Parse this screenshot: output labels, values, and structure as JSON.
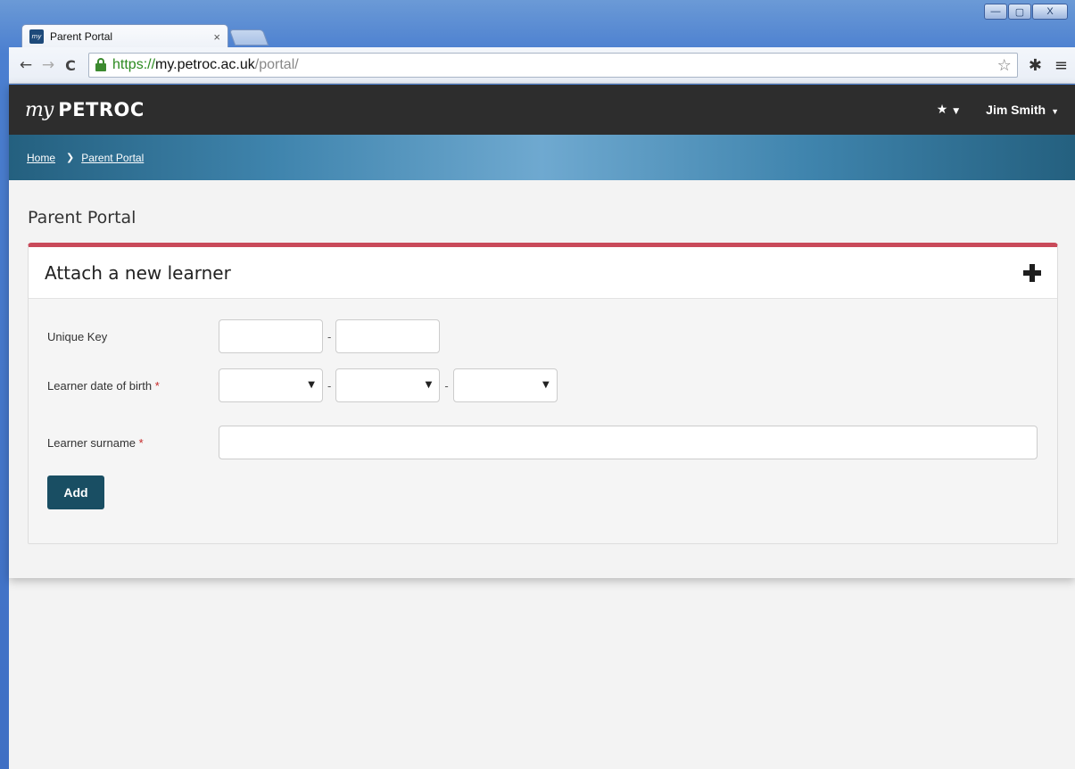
{
  "browser": {
    "tab_title": "Parent Portal",
    "tab_close": "×",
    "url_scheme": "https://",
    "url_host": "my.petroc.ac.uk",
    "url_path": "/portal/",
    "window_controls": {
      "minimize": "—",
      "maximize": "▢",
      "close": "X"
    }
  },
  "header": {
    "logo_my": "my",
    "logo_petroc": "PETROC",
    "favorites_label": "★",
    "user_name": "Jim Smith"
  },
  "breadcrumb": {
    "items": [
      "Home",
      "Parent Portal"
    ]
  },
  "page": {
    "title": "Parent Portal"
  },
  "panel": {
    "title": "Attach a new learner",
    "accent_color": "#c94a5a",
    "fields": {
      "unique_key_label": "Unique Key",
      "dob_label": "Learner date of birth",
      "surname_label": "Learner surname",
      "required_mark": "*",
      "separator": "-"
    },
    "add_button": "Add"
  },
  "colors": {
    "header_bg": "#2d2d2d",
    "breadcrumb_bg": "#3f84ad",
    "button_bg": "#194e63"
  }
}
